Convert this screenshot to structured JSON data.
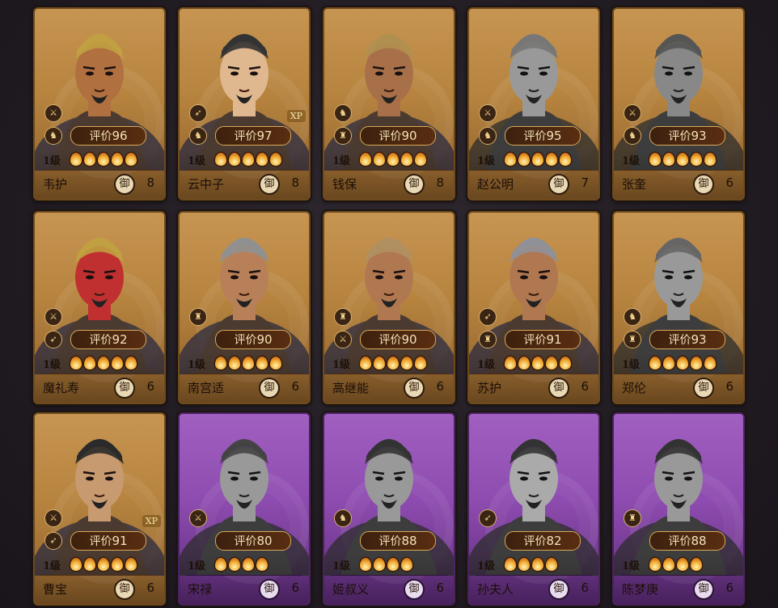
{
  "cards": [
    {
      "name": "韦护",
      "rating_label": "评价",
      "rating": "96",
      "level": "1级",
      "flames": 5,
      "def_label": "御",
      "def": "8",
      "frame": "gold",
      "gray": false,
      "xp": "",
      "badges": [
        "⚔",
        "♞"
      ],
      "skin": "#b07040",
      "helmet": "#c0a040"
    },
    {
      "name": "云中子",
      "rating_label": "评价",
      "rating": "97",
      "level": "1级",
      "flames": 5,
      "def_label": "御",
      "def": "8",
      "frame": "gold",
      "gray": false,
      "xp": "XP",
      "badges": [
        "➶",
        "♞"
      ],
      "skin": "#e0b890",
      "helmet": "#333333"
    },
    {
      "name": "钱保",
      "rating_label": "评价",
      "rating": "90",
      "level": "1级",
      "flames": 5,
      "def_label": "御",
      "def": "8",
      "frame": "gold",
      "gray": false,
      "xp": "",
      "badges": [
        "♞",
        "♜"
      ],
      "skin": "#a87048",
      "helmet": "#b09050"
    },
    {
      "name": "赵公明",
      "rating_label": "评价",
      "rating": "95",
      "level": "1级",
      "flames": 5,
      "def_label": "御",
      "def": "7",
      "frame": "gold",
      "gray": true,
      "xp": "",
      "badges": [
        "⚔",
        "♞"
      ],
      "skin": "#999999",
      "helmet": "#777777"
    },
    {
      "name": "张奎",
      "rating_label": "评价",
      "rating": "93",
      "level": "1级",
      "flames": 5,
      "def_label": "御",
      "def": "6",
      "frame": "gold",
      "gray": true,
      "xp": "",
      "badges": [
        "⚔",
        "♞"
      ],
      "skin": "#888888",
      "helmet": "#555555"
    },
    {
      "name": "魔礼寿",
      "rating_label": "评价",
      "rating": "92",
      "level": "1级",
      "flames": 5,
      "def_label": "御",
      "def": "6",
      "frame": "gold",
      "gray": false,
      "xp": "",
      "badges": [
        "⚔",
        "➶"
      ],
      "skin": "#c03030",
      "helmet": "#c0a040"
    },
    {
      "name": "南宫适",
      "rating_label": "评价",
      "rating": "90",
      "level": "1级",
      "flames": 5,
      "def_label": "御",
      "def": "6",
      "frame": "gold",
      "gray": false,
      "xp": "",
      "badges": [
        "♜"
      ],
      "skin": "#b88058",
      "helmet": "#909090"
    },
    {
      "name": "高继能",
      "rating_label": "评价",
      "rating": "90",
      "level": "1级",
      "flames": 5,
      "def_label": "御",
      "def": "6",
      "frame": "gold",
      "gray": false,
      "xp": "",
      "badges": [
        "♜",
        "⚔"
      ],
      "skin": "#b07850",
      "helmet": "#b09060"
    },
    {
      "name": "苏护",
      "rating_label": "评价",
      "rating": "91",
      "level": "1级",
      "flames": 5,
      "def_label": "御",
      "def": "6",
      "frame": "gold",
      "gray": false,
      "xp": "",
      "badges": [
        "➶",
        "♜"
      ],
      "skin": "#b07850",
      "helmet": "#909098"
    },
    {
      "name": "郑伦",
      "rating_label": "评价",
      "rating": "93",
      "level": "1级",
      "flames": 5,
      "def_label": "御",
      "def": "6",
      "frame": "gold",
      "gray": true,
      "xp": "",
      "badges": [
        "♞",
        "♜"
      ],
      "skin": "#999999",
      "helmet": "#666666"
    },
    {
      "name": "曹宝",
      "rating_label": "评价",
      "rating": "91",
      "level": "1级",
      "flames": 5,
      "def_label": "御",
      "def": "6",
      "frame": "gold",
      "gray": false,
      "xp": "XP",
      "badges": [
        "⚔",
        "➶"
      ],
      "skin": "#c89a70",
      "helmet": "#2a2a2a"
    },
    {
      "name": "宋禄",
      "rating_label": "评价",
      "rating": "80",
      "level": "1级",
      "flames": 4,
      "def_label": "御",
      "def": "6",
      "frame": "purple",
      "gray": true,
      "xp": "",
      "badges": [
        "⚔"
      ],
      "skin": "#999999",
      "helmet": "#444444"
    },
    {
      "name": "姬叔义",
      "rating_label": "评价",
      "rating": "88",
      "level": "1级",
      "flames": 4,
      "def_label": "御",
      "def": "6",
      "frame": "purple",
      "gray": true,
      "xp": "",
      "badges": [
        "♞"
      ],
      "skin": "#999999",
      "helmet": "#333333"
    },
    {
      "name": "孙夫人",
      "rating_label": "评价",
      "rating": "82",
      "level": "1级",
      "flames": 4,
      "def_label": "御",
      "def": "6",
      "frame": "purple",
      "gray": true,
      "xp": "",
      "badges": [
        "➶"
      ],
      "skin": "#aaaaaa",
      "helmet": "#333333"
    },
    {
      "name": "陈梦庚",
      "rating_label": "评价",
      "rating": "88",
      "level": "1级",
      "flames": 4,
      "def_label": "御",
      "def": "6",
      "frame": "purple",
      "gray": true,
      "xp": "",
      "badges": [
        "♜"
      ],
      "skin": "#999999",
      "helmet": "#333333"
    }
  ]
}
